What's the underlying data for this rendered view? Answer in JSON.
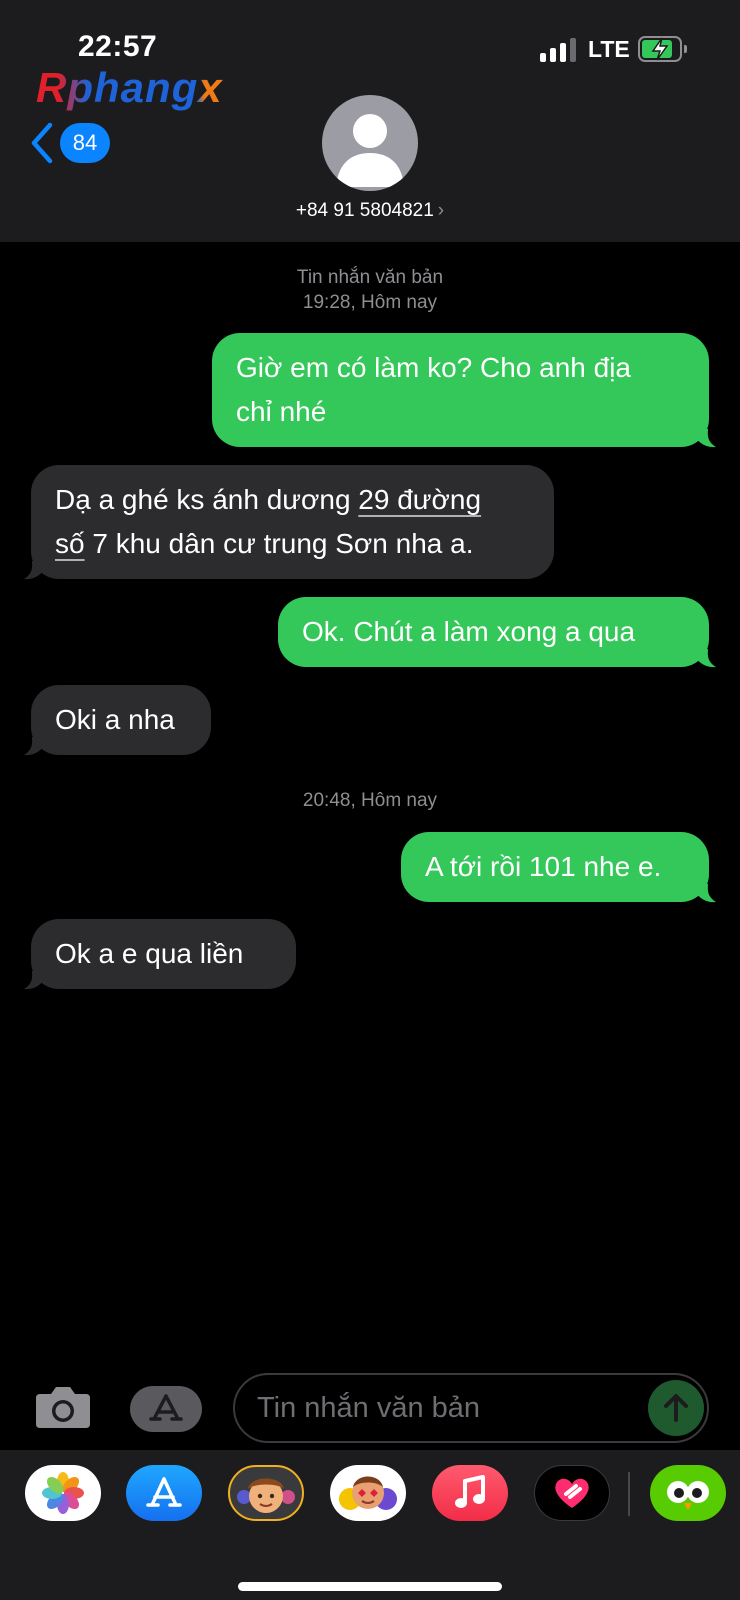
{
  "status_bar": {
    "time": "22:57",
    "network": "LTE",
    "signal_bars_active": 3,
    "signal_bars_total": 4,
    "battery_fraction": 0.75,
    "battery_charging": true
  },
  "watermark": {
    "text": "Rphangx"
  },
  "header": {
    "back_badge": "84",
    "contact": "+84 91 5804821",
    "chevron": "›"
  },
  "conversation": {
    "label": "Tin nhắn văn bản",
    "timestamps": [
      "19:28, Hôm nay",
      "20:48, Hôm nay"
    ],
    "messages": [
      {
        "direction": "outgoing",
        "lines": [
          "Giờ em có làm ko? Cho anh địa",
          "chỉ nhé"
        ]
      },
      {
        "direction": "incoming",
        "line1_plain": "Dạ a ghé ks ánh dương ",
        "line1_link": "29 đường",
        "line2_link": "số",
        "line2_plain": " 7 khu dân cư trung Sơn nha a."
      },
      {
        "direction": "outgoing",
        "text": "Ok. Chút a làm xong a qua"
      },
      {
        "direction": "incoming",
        "text": "Oki a nha"
      },
      {
        "direction": "outgoing",
        "text": "A tới rồi 101 nhe e."
      },
      {
        "direction": "incoming",
        "text": "Ok a e qua liền"
      }
    ]
  },
  "composer": {
    "placeholder": "Tin nhắn văn bản"
  },
  "app_strip": {
    "apps": [
      "photos-icon",
      "app-store-icon",
      "memoji-icon",
      "animoji-stickers-icon",
      "music-icon",
      "fitness-heart-icon",
      "duolingo-icon"
    ]
  },
  "colors": {
    "outgoing_bubble": "#34c759",
    "incoming_bubble": "#2c2c2e",
    "header_bg": "#1c1c1e",
    "accent": "#0a84ff"
  }
}
